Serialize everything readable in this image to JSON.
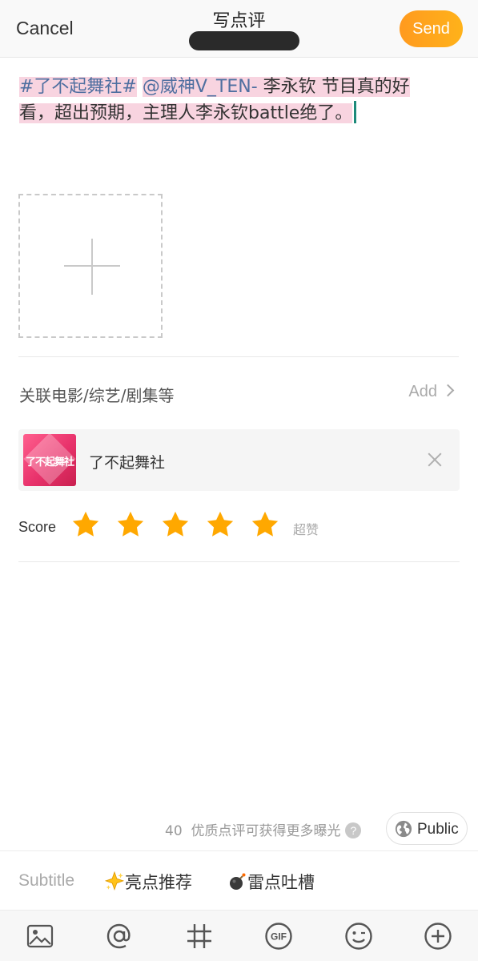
{
  "header": {
    "cancel_label": "Cancel",
    "title": "写点评",
    "send_label": "Send",
    "accent_color": "#ffa41c"
  },
  "editor": {
    "topic": "#了不起舞社#",
    "mention": "@威神V_TEN-",
    "text_line1": " 李永钦 节目真的好",
    "text_line2": "看，超出预期，主理人李永钦battle绝了。"
  },
  "add_image": {
    "icon": "plus-icon"
  },
  "related": {
    "label": "关联电影/综艺/剧集等",
    "add_label": "Add",
    "item": {
      "title": "了不起舞社",
      "poster_text": "了不起舞社"
    }
  },
  "score": {
    "label": "Score",
    "rating": 5,
    "max": 5,
    "rating_text": "超赞",
    "star_color": "#ffa800"
  },
  "footer": {
    "char_count": "40",
    "tip_text": "优质点评可获得更多曝光",
    "help_icon": "?",
    "visibility_label": "Public"
  },
  "options": {
    "subtitle_label": "Subtitle",
    "highlight_label": "亮点推荐",
    "rant_label": "雷点吐槽"
  },
  "toolbar": {
    "items": [
      "image-icon",
      "at-icon",
      "hashtag-icon",
      "gif-icon",
      "emoji-icon",
      "add-icon"
    ]
  }
}
